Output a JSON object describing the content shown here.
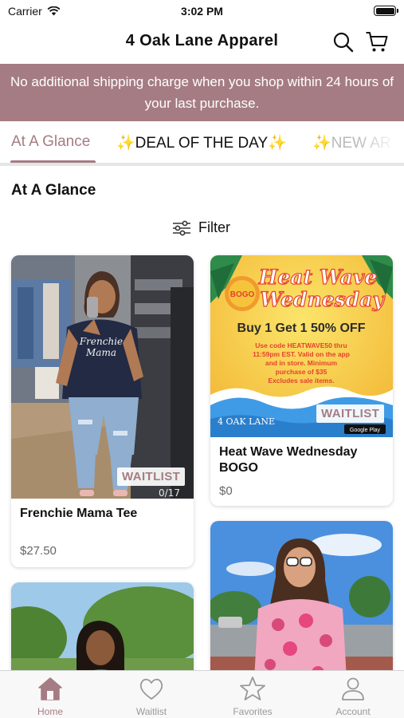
{
  "status_bar": {
    "carrier": "Carrier",
    "time": "3:02 PM"
  },
  "header": {
    "title": "4 Oak Lane Apparel"
  },
  "promo": {
    "text": "No additional shipping charge when you shop within 24 hours of your last purchase."
  },
  "tabs": [
    {
      "label": "At A Glance",
      "active": true
    },
    {
      "label": "✨DEAL OF THE DAY✨",
      "active": false
    },
    {
      "label": "✨NEW AR",
      "active": false
    }
  ],
  "section": {
    "title": "At A Glance",
    "filter_label": "Filter"
  },
  "products": [
    {
      "name": "Frenchie Mama Tee",
      "price": "$27.50",
      "badge": "WAITLIST",
      "shirt_text": "Frenchie Mama"
    },
    {
      "name": "Heat Wave Wednesday BOGO",
      "price": "$0",
      "badge": "WAITLIST",
      "promo_image": {
        "bogo": "BOGO",
        "headline_1": "Heat Wave",
        "headline_2": "Wednesday",
        "offer": "Buy 1 Get 1 50% OFF",
        "details": "Use code HEATWAVE50 thru 11:59pm EST. Valid on the app and in store. Minimum purchase of $35 Excludes sale items.",
        "logo": "4 OAK LANE",
        "store_badge": "Google Play"
      }
    }
  ],
  "tab_bar": [
    {
      "label": "Home",
      "icon": "home-icon",
      "active": true
    },
    {
      "label": "Waitlist",
      "icon": "heart-icon",
      "active": false
    },
    {
      "label": "Favorites",
      "icon": "star-icon",
      "active": false
    },
    {
      "label": "Account",
      "icon": "person-icon",
      "active": false
    }
  ],
  "colors": {
    "accent": "#a57c83",
    "promo_yellow": "#f5d23a",
    "promo_orange": "#f29a2e",
    "promo_red": "#e6402e",
    "sky": "#3f9be6"
  }
}
